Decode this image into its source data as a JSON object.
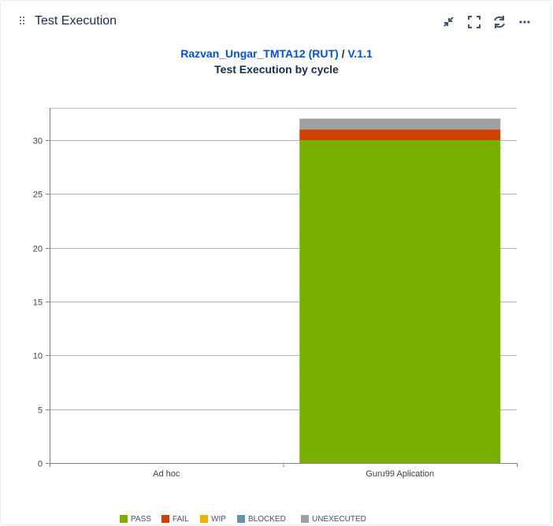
{
  "gadget": {
    "title": "Test Execution",
    "actions": [
      {
        "name": "minimize-button",
        "icon": "minimize-icon"
      },
      {
        "name": "fullscreen-button",
        "icon": "fullscreen-icon"
      },
      {
        "name": "refresh-button",
        "icon": "refresh-icon"
      },
      {
        "name": "more-button",
        "icon": "more-icon"
      }
    ]
  },
  "project": {
    "name": "Razvan_Ungar_TMTA12 (RUT)",
    "separator": "/",
    "version": "V.1.1"
  },
  "chart_data": {
    "type": "bar",
    "stacked": true,
    "title": "Test Execution by cycle",
    "categories": [
      "Ad hoc",
      "Guru99 Aplication"
    ],
    "series": [
      {
        "name": "PASS",
        "color": "#78b000",
        "values": [
          0,
          30
        ]
      },
      {
        "name": "FAIL",
        "color": "#d04000",
        "values": [
          0,
          1
        ]
      },
      {
        "name": "WIP",
        "color": "#f0b000",
        "values": [
          0,
          0
        ]
      },
      {
        "name": "BLOCKED",
        "color": "#6693b0",
        "values": [
          0,
          0
        ]
      },
      {
        "name": "UNEXECUTED",
        "color": "#a0a0a0",
        "values": [
          0,
          1
        ]
      }
    ],
    "ylim": [
      0,
      33
    ],
    "yticks": [
      0,
      5,
      10,
      15,
      20,
      25,
      30
    ],
    "grid": true,
    "legend_position": "bottom"
  }
}
